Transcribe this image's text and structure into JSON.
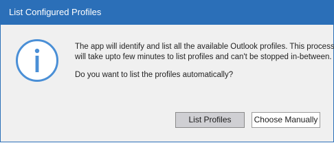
{
  "window": {
    "title": "List Configured Profiles"
  },
  "message": {
    "line1": "The app will identify and list all the available Outlook profiles. This process",
    "line2": "will take upto few minutes to list profiles and can't be stopped in-between.",
    "question": "Do you want to list the profiles automatically?"
  },
  "buttons": {
    "list_profiles": "List Profiles",
    "choose_manually": "Choose Manually"
  },
  "icons": {
    "info": "info-icon"
  },
  "colors": {
    "titlebar": "#2b6fb8",
    "icon": "#4a8fd6",
    "background": "#f0f0f0"
  }
}
